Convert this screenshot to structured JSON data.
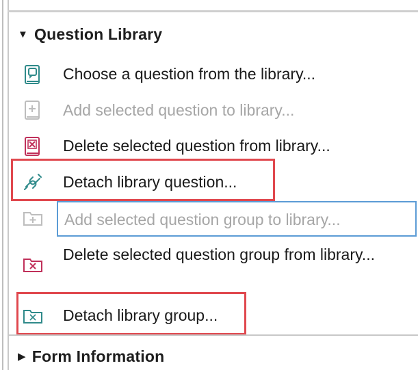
{
  "question_library": {
    "header": "Question Library",
    "header_icon": "caret-down-icon",
    "items": [
      {
        "label": "Choose a question from the library...",
        "icon": "library-book-icon",
        "enabled": true
      },
      {
        "label": "Add selected question to library...",
        "icon": "add-to-library-icon",
        "enabled": false
      },
      {
        "label": "Delete selected question from library...",
        "icon": "delete-from-library-icon",
        "enabled": true
      },
      {
        "label": "Detach library question...",
        "icon": "detach-link-icon",
        "enabled": true,
        "highlighted": true
      },
      {
        "label": "Add selected question group to library...",
        "icon": "add-folder-icon",
        "enabled": false
      },
      {
        "label": "Delete selected question group from library...",
        "icon": "delete-folder-icon",
        "enabled": true
      },
      {
        "label": "Detach library group...",
        "icon": "detach-folder-icon",
        "enabled": true,
        "highlighted": true
      }
    ]
  },
  "form_information": {
    "header": "Form Information",
    "header_icon": "caret-right-icon"
  },
  "colors": {
    "highlight_border": "#e0484e",
    "input_border": "#5b9bd5",
    "disabled_text": "#a6a6a6",
    "teal_icon": "#2f8a8a",
    "pink_icon": "#c0305a"
  }
}
